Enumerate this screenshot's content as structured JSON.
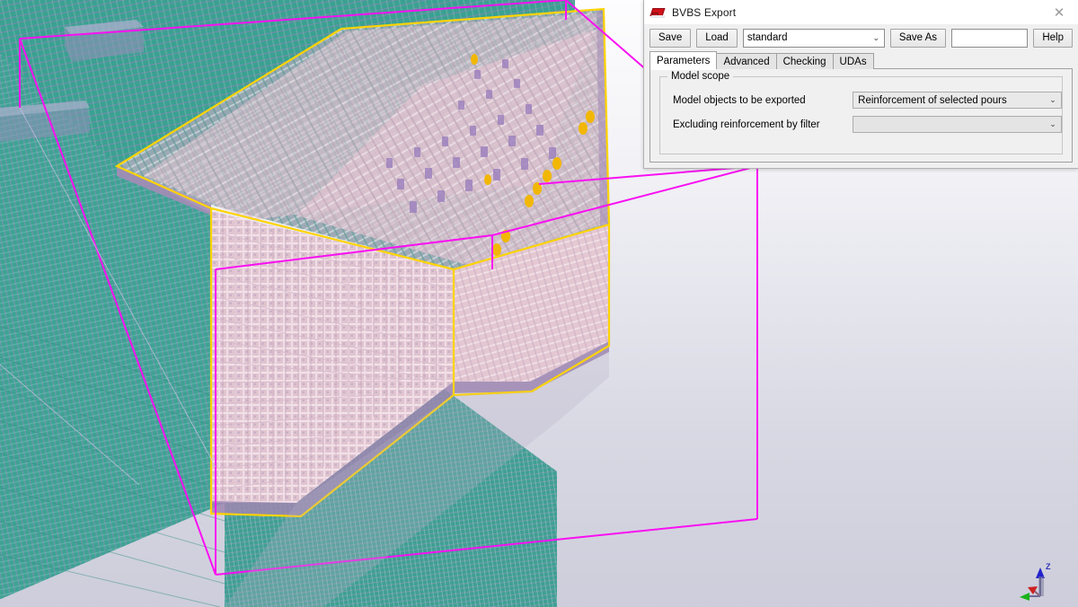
{
  "dialog": {
    "title": "BVBS Export",
    "icon": "bvbs-app-icon",
    "close_label": "✕",
    "toolbar": {
      "save_label": "Save",
      "load_label": "Load",
      "attribute_combo_value": "standard",
      "save_as_label": "Save As",
      "name_field_value": "",
      "name_field_placeholder": "",
      "help_label": "Help",
      "dropdown_arrow": "⌄"
    },
    "tabs": [
      {
        "label": "Parameters",
        "active": true
      },
      {
        "label": "Advanced",
        "active": false
      },
      {
        "label": "Checking",
        "active": false
      },
      {
        "label": "UDAs",
        "active": false
      }
    ],
    "parameters_tab": {
      "group_title": "Model scope",
      "fields": [
        {
          "label": "Model objects to be exported",
          "value": "Reinforcement of selected pours",
          "state": "filled"
        },
        {
          "label": "Excluding reinforcement by filter",
          "value": "",
          "state": "empty"
        }
      ]
    }
  },
  "viewport": {
    "name": "tekla-3d-model-view",
    "background_top_color": "#fdfdfe",
    "background_bottom_color": "#cdcddb",
    "selection_highlight_color": "#ffd400",
    "pour_boundary_color": "#ff00ff",
    "rebar_mesh_color": "#2f9e8e",
    "selected_pour_color": "#e9c9d2",
    "bar_end_marker_color": "#f0b400",
    "axis_triad": {
      "z_label": "Z",
      "z_axis_color": "#2020d0",
      "x_axis_color": "#d02020",
      "y_axis_color": "#20c020"
    }
  }
}
